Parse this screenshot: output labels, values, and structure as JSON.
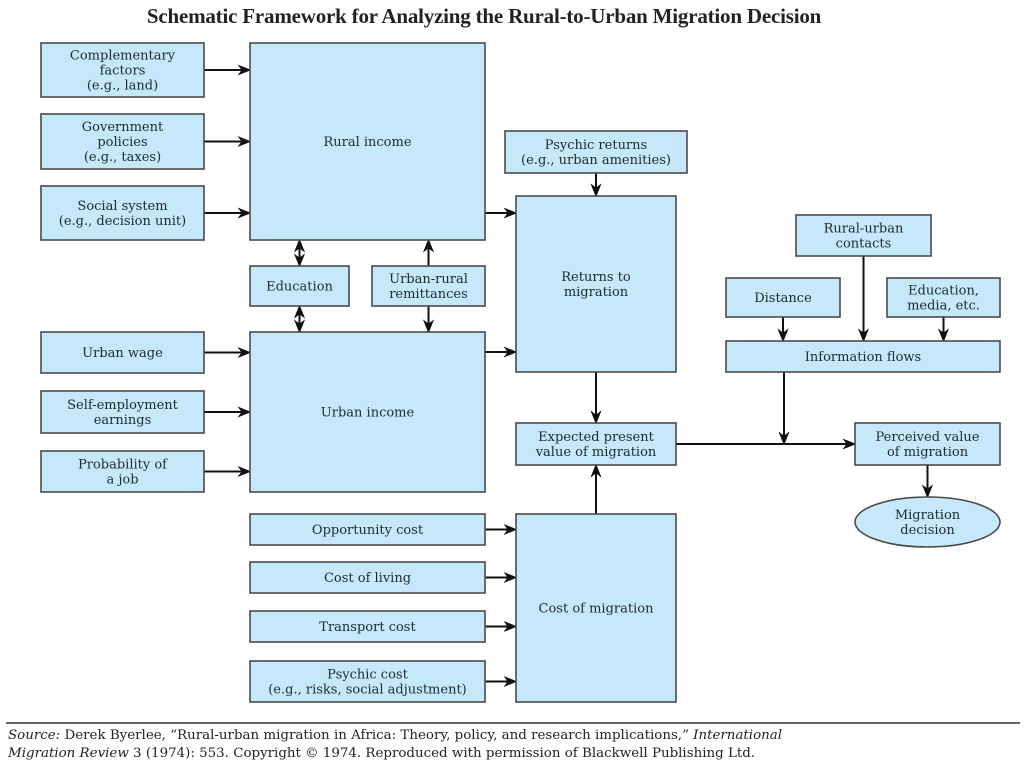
{
  "title": "Schematic Framework for Analyzing the Rural-to-Urban Migration Decision",
  "nodes": {
    "complementary": [
      "Complementary",
      "factors",
      "(e.g., land)"
    ],
    "government": [
      "Government",
      "policies",
      "(e.g., taxes)"
    ],
    "social": [
      "Social system",
      "(e.g., decision unit)"
    ],
    "rural_income": [
      "Rural income"
    ],
    "education": [
      "Education"
    ],
    "remittances": [
      "Urban-rural",
      "remittances"
    ],
    "urban_wage": [
      "Urban wage"
    ],
    "self_employment": [
      "Self-employment",
      "earnings"
    ],
    "probability_job": [
      "Probability of",
      "a job"
    ],
    "urban_income": [
      "Urban income"
    ],
    "psychic_returns": [
      "Psychic returns",
      "(e.g., urban amenities)"
    ],
    "returns_migration": [
      "Returns to",
      "migration"
    ],
    "expected_pv": [
      "Expected present",
      "value of migration"
    ],
    "opportunity_cost": [
      "Opportunity cost"
    ],
    "cost_living": [
      "Cost of living"
    ],
    "transport_cost": [
      "Transport cost"
    ],
    "psychic_cost": [
      "Psychic cost",
      "(e.g., risks, social adjustment)"
    ],
    "cost_migration": [
      "Cost of migration"
    ],
    "rural_urban_contacts": [
      "Rural-urban",
      "contacts"
    ],
    "distance": [
      "Distance"
    ],
    "education_media": [
      "Education,",
      "media, etc."
    ],
    "information_flows": [
      "Information flows"
    ],
    "perceived_value": [
      "Perceived value",
      "of migration"
    ],
    "migration_decision": [
      "Migration",
      "decision"
    ]
  },
  "edges": [
    [
      "complementary",
      "rural_income"
    ],
    [
      "government",
      "rural_income"
    ],
    [
      "social",
      "rural_income"
    ],
    [
      "education",
      "rural_income",
      "both"
    ],
    [
      "education",
      "urban_income",
      "both"
    ],
    [
      "remittances",
      "rural_income"
    ],
    [
      "remittances",
      "urban_income"
    ],
    [
      "urban_wage",
      "urban_income"
    ],
    [
      "self_employment",
      "urban_income"
    ],
    [
      "probability_job",
      "urban_income"
    ],
    [
      "rural_income",
      "returns_migration"
    ],
    [
      "urban_income",
      "returns_migration"
    ],
    [
      "psychic_returns",
      "returns_migration"
    ],
    [
      "returns_migration",
      "expected_pv"
    ],
    [
      "cost_migration",
      "expected_pv"
    ],
    [
      "opportunity_cost",
      "cost_migration"
    ],
    [
      "cost_living",
      "cost_migration"
    ],
    [
      "transport_cost",
      "cost_migration"
    ],
    [
      "psychic_cost",
      "cost_migration"
    ],
    [
      "distance",
      "information_flows"
    ],
    [
      "rural_urban_contacts",
      "information_flows"
    ],
    [
      "education_media",
      "information_flows"
    ],
    [
      "expected_pv",
      "perceived_value"
    ],
    [
      "information_flows",
      "perceived_value"
    ],
    [
      "perceived_value",
      "migration_decision"
    ]
  ],
  "source": {
    "label": "Source:",
    "text1": " Derek Byerlee, “Rural-urban migration in Africa: Theory, policy, and research implications,” ",
    "journal1": "International",
    "journal2": "Migration Review",
    "text2": " 3 (1974): 553. Copyright © 1974. Reproduced with permission of Blackwell Publishing Ltd."
  }
}
